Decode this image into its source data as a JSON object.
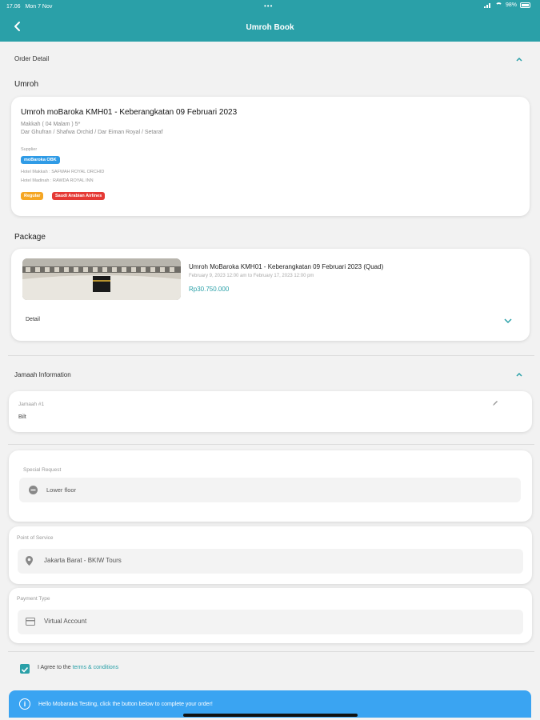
{
  "status": {
    "time": "17.06",
    "date": "Mon 7 Nov",
    "battery": "98%"
  },
  "app_bar": {
    "title": "Umroh Book"
  },
  "order_detail": {
    "heading": "Order Detail",
    "umroh_label": "Umroh",
    "umroh": {
      "title": "Umroh moBaroka KMH01 - Keberangkatan 09 Februari 2023",
      "location": "Makkah ( 04 Malam ) 5*",
      "hotels": "Dar Ghufran / Shafwa Orchid / Dar Eiman Royal / Setaraf",
      "supplier_label": "Supplier",
      "supplier_badge": "moBaroka OBK",
      "hotel_makkah": "Hotel Makkah : SAFWAH ROYAL ORCHID",
      "hotel_madinah": "Hotel Madinah : RAWDA ROYAL INN",
      "badges": [
        "Regular",
        "Saudi Arabian Airlines"
      ]
    },
    "package_label": "Package",
    "package": {
      "title": "Umroh MoBaroka KMH01 - Keberangkatan 09 Februari 2023 (Quad)",
      "dates": "February 9, 2023 12:00 am to February 17, 2023 12:00 pm",
      "price": "Rp30.750.000",
      "detail_label": "Detail"
    }
  },
  "jamaah": {
    "heading": "Jamaah Information",
    "item_label": "Jamaah #1",
    "item_value": "Bilt"
  },
  "special_request": {
    "label": "Special Request",
    "value": "Lower floor"
  },
  "point_of_service": {
    "label": "Point of Service",
    "value": "Jakarta Barat - BKIW Tours"
  },
  "payment_type": {
    "label": "Payment Type",
    "value": "Virtual Account"
  },
  "agreement": {
    "text": "I Agree to the ",
    "link": "terms & conditions",
    "checked": true
  },
  "banner": {
    "text": "Hello Mobaraka Testing, click the button below to complete your order!"
  },
  "colors": {
    "primary": "#2aa0a8",
    "banner": "#3aa4f2",
    "badge_supplier": "#2f9be6",
    "badge_regular": "#f5a623",
    "badge_airline": "#e53935"
  }
}
